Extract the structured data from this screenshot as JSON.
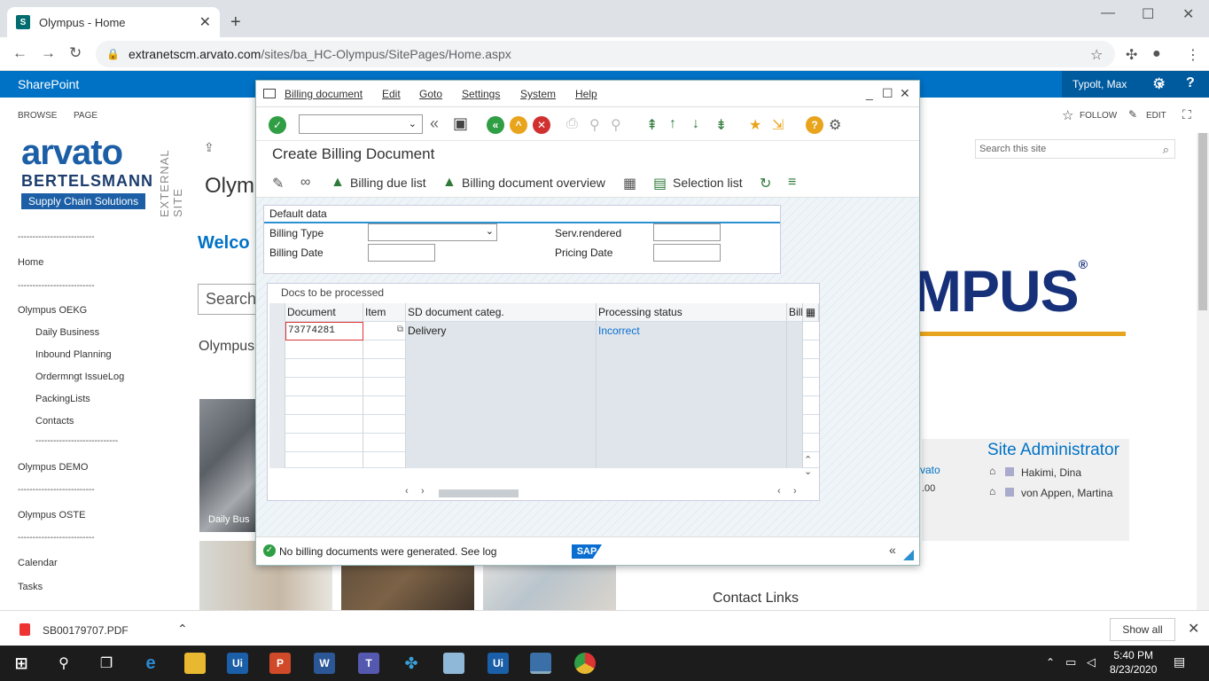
{
  "browser": {
    "tab_title": "Olympus - Home",
    "tab_favicon": "S",
    "url_host": "extranetscm.arvato.com",
    "url_path": "/sites/ba_HC-Olympus/SitePages/Home.aspx"
  },
  "sharepoint": {
    "suite": "SharePoint",
    "user": "Typolt, Max",
    "user_caret": "▾",
    "browse": "BROWSE",
    "page": "PAGE",
    "follow": "FOLLOW",
    "edit": "EDIT",
    "logo_main": "arvato",
    "logo_sub": "BERTELSMANN",
    "logo_tag": "Supply Chain Solutions",
    "external": "EXTERNAL SITE",
    "search_placeholder": "Search this site",
    "page_title": "Olymp",
    "welcome": "Welco",
    "search_box": "Search",
    "olympus_text": "Olympus",
    "nav": {
      "sep": "--------------------------",
      "sep2": "----------------------------",
      "home": "Home",
      "oekg": "Olympus OEKG",
      "daily": "Daily Business",
      "inbound": "Inbound Planning",
      "ordermgmt": "Ordermngt IssueLog",
      "packing": "PackingLists",
      "contacts": "Contacts",
      "demo": "Olympus DEMO",
      "oste": "Olympus OSTE",
      "calendar": "Calendar",
      "tasks": "Tasks"
    },
    "tile1": "Daily Bus",
    "brand": "MPUS",
    "brand_reg": "®",
    "admin_title": "Site Administrator",
    "admin1": "Hakimi, Dina",
    "admin2": "von Appen, Martina",
    "arvato_link": "l, arvato",
    "n00": ".00",
    "contact_links": "Contact Links"
  },
  "sap": {
    "menu": [
      "Billing document",
      "Edit",
      "Goto",
      "Settings",
      "System",
      "Help"
    ],
    "title": "Create Billing Document",
    "app": {
      "edit_label": "",
      "billing_due": "Billing due list",
      "overview": "Billing document overview",
      "selection": "Selection list"
    },
    "default_data": "Default data",
    "fields": {
      "billing_type": "Billing Type",
      "billing_date": "Billing Date",
      "serv_rendered": "Serv.rendered",
      "pricing_date": "Pricing Date"
    },
    "table_caption": "Docs to be processed",
    "columns": [
      "Document",
      "Item",
      "SD document categ.",
      "Processing status",
      "Billi"
    ],
    "rows": [
      {
        "document": "73774281",
        "item": "",
        "categ": "Delivery",
        "status": "Incorrect"
      }
    ],
    "status_msg": "No billing documents were generated. See log",
    "sap_logo": "SAP",
    "status_collapse": "«"
  },
  "download": {
    "file": "SB00179707.PDF",
    "show_all": "Show all"
  },
  "taskbar": {
    "time": "5:40 PM",
    "date": "8/23/2020",
    "ui": "Ui",
    "word": "W",
    "ppt": "P",
    "teams": "T"
  },
  "colors": {
    "accent": "#0072c6",
    "sap_blue": "#2c8fcf",
    "brand_navy": "#16307a",
    "brand_gold": "#e8a41c"
  }
}
